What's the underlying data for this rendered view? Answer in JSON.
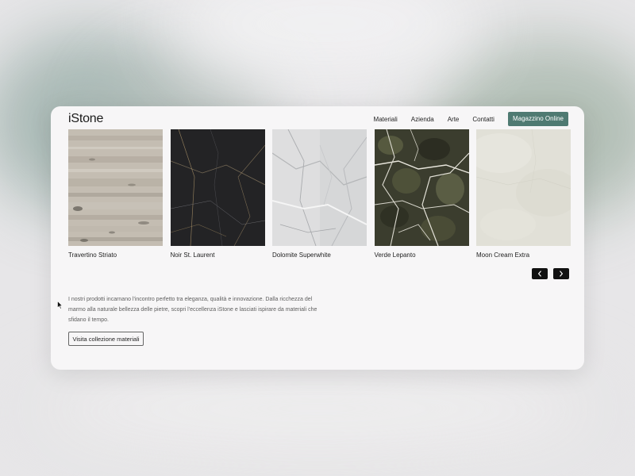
{
  "header": {
    "logo": "iStone",
    "nav": [
      {
        "label": "Materiali"
      },
      {
        "label": "Azienda"
      },
      {
        "label": "Arte"
      },
      {
        "label": "Contatti"
      }
    ],
    "cta_label": "Magazzino Online"
  },
  "products": [
    {
      "name": "Travertino Striato"
    },
    {
      "name": "Noir St. Laurent"
    },
    {
      "name": "Dolomite Superwhite"
    },
    {
      "name": "Verde Lepanto"
    },
    {
      "name": "Moon Cream Extra"
    }
  ],
  "carousel": {
    "prev_icon": "chevron-left-icon",
    "next_icon": "chevron-right-icon"
  },
  "intro": {
    "text": "I nostri prodotti incarnano l'incontro perfetto tra eleganza, qualità e innovazione. Dalla ricchezza del marmo alla naturale bellezza delle pietre, scopri l'eccellenza iStone e lasciati ispirare da materiali che sfidano il tempo.",
    "button_label": "Visita collezione materiali"
  },
  "colors": {
    "accent": "#4f7a72",
    "background": "#e7e6e8",
    "card": "#f7f6f7",
    "text": "#1e1e1e"
  }
}
